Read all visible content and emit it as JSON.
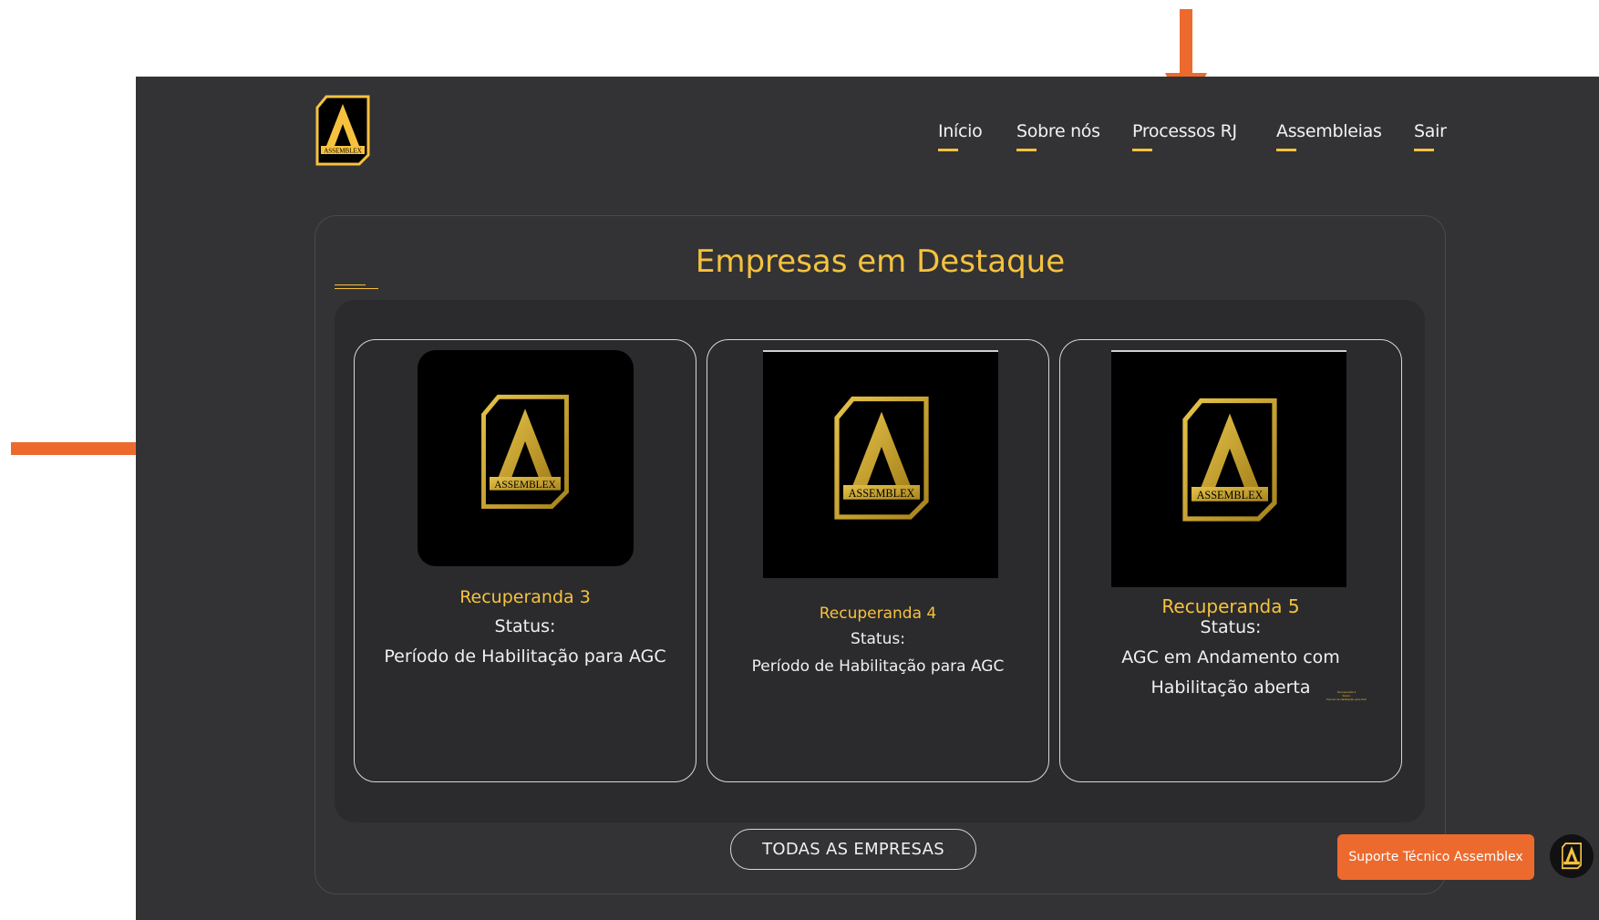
{
  "nav": {
    "items": [
      "Início",
      "Sobre nós",
      "Processos RJ",
      "Assembleias",
      "Sair"
    ]
  },
  "logo": {
    "text": "ASSEMBLEX"
  },
  "section": {
    "title": "Empresas em Destaque"
  },
  "cards": [
    {
      "name": "Recuperanda 3",
      "status_label": "Status:",
      "status_lines": [
        "Período de Habilitação para AGC"
      ]
    },
    {
      "name": "Recuperanda 4",
      "status_label": "Status:",
      "status_lines": [
        "Período de Habilitação para AGC"
      ]
    },
    {
      "name": "Recuperanda 5",
      "status_label": "Status:",
      "status_lines": [
        "AGC em Andamento com",
        "Habilitação aberta"
      ]
    }
  ],
  "tiny_overlay": [
    "Recuperanda 3",
    "Status:",
    "Período de Habilitação para AGC"
  ],
  "buttons": {
    "all_companies": "TODAS AS EMPRESAS",
    "support": "Suporte Técnico Assemblex"
  },
  "colors": {
    "accent": "#f6c23e",
    "background": "#333335",
    "annotation_arrow": "#ec6a2e",
    "support": "#ec6a2e"
  },
  "icons": [
    "assemblex-logo-icon",
    "chat-icon",
    "arrow-down-icon",
    "arrow-right-icon",
    "arrow-left-icon"
  ]
}
